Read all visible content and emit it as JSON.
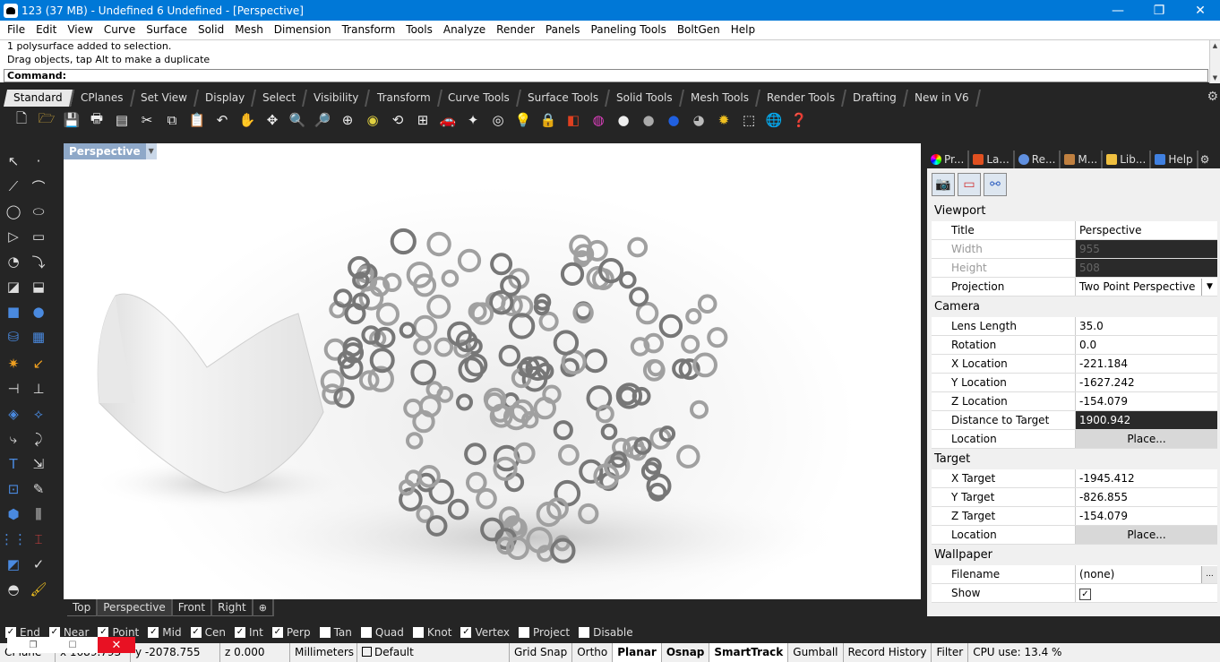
{
  "window": {
    "title": "123 (37 MB) - Undefined 6 Undefined - [Perspective]",
    "minimize": "—",
    "restore": "❐",
    "close": "✕"
  },
  "menu": [
    "File",
    "Edit",
    "View",
    "Curve",
    "Surface",
    "Solid",
    "Mesh",
    "Dimension",
    "Transform",
    "Tools",
    "Analyze",
    "Render",
    "Panels",
    "Paneling Tools",
    "BoltGen",
    "Help"
  ],
  "command": {
    "history": [
      "1 polysurface added to selection.",
      "Drag objects, tap Alt to make a duplicate"
    ],
    "prompt": "Command:",
    "value": ""
  },
  "toolbar_tabs": [
    "Standard",
    "CPlanes",
    "Set View",
    "Display",
    "Select",
    "Visibility",
    "Transform",
    "Curve Tools",
    "Surface Tools",
    "Solid Tools",
    "Mesh Tools",
    "Render Tools",
    "Drafting",
    "New in V6"
  ],
  "toolbar_icons": [
    "new-file-icon",
    "open-file-icon",
    "save-icon",
    "print-icon",
    "import-icon",
    "cut-icon",
    "copy-icon",
    "paste-icon",
    "undo-icon",
    "pan-hand-icon",
    "move-icon",
    "zoom-icon",
    "zoom-window-icon",
    "zoom-extents-icon",
    "zoom-selected-icon",
    "rotate-view-icon",
    "four-viewports-icon",
    "car-icon",
    "point-icon",
    "circle-icon",
    "light-icon",
    "lock-icon",
    "layer-icon",
    "color-wheel-icon",
    "sphere-grey-icon",
    "sphere-dark-icon",
    "sphere-blue-icon",
    "sphere-rendered-icon",
    "gear-sun-icon",
    "dashed-window-icon",
    "globe-icon",
    "help-icon"
  ],
  "viewport": {
    "title": "Perspective"
  },
  "viewport_tabs": [
    "Top",
    "Perspective",
    "Front",
    "Right"
  ],
  "panel": {
    "tabs": [
      "Pr...",
      "La...",
      "Re...",
      "M...",
      "Lib...",
      "Help"
    ],
    "sections": {
      "viewport": "Viewport",
      "camera": "Camera",
      "target": "Target",
      "wallpaper": "Wallpaper"
    },
    "viewport_rows": {
      "title_label": "Title",
      "title_value": "Perspective",
      "width_label": "Width",
      "width_value": "955",
      "height_label": "Height",
      "height_value": "508",
      "projection_label": "Projection",
      "projection_value": "Two Point Perspective"
    },
    "camera_rows": {
      "lens_label": "Lens Length",
      "lens_value": "35.0",
      "rotation_label": "Rotation",
      "rotation_value": "0.0",
      "x_label": "X Location",
      "x_value": "-221.184",
      "y_label": "Y Location",
      "y_value": "-1627.242",
      "z_label": "Z Location",
      "z_value": "-154.079",
      "dist_label": "Distance to Target",
      "dist_value": "1900.942",
      "loc_label": "Location",
      "loc_button": "Place..."
    },
    "target_rows": {
      "x_label": "X Target",
      "x_value": "-1945.412",
      "y_label": "Y Target",
      "y_value": "-826.855",
      "z_label": "Z Target",
      "z_value": "-154.079",
      "loc_label": "Location",
      "loc_button": "Place..."
    },
    "wallpaper_rows": {
      "file_label": "Filename",
      "file_value": "(none)",
      "file_button": "...",
      "show_label": "Show",
      "show_checked": true
    }
  },
  "osnaps": [
    {
      "label": "End",
      "checked": true
    },
    {
      "label": "Near",
      "checked": true
    },
    {
      "label": "Point",
      "checked": true
    },
    {
      "label": "Mid",
      "checked": true
    },
    {
      "label": "Cen",
      "checked": true
    },
    {
      "label": "Int",
      "checked": true
    },
    {
      "label": "Perp",
      "checked": true
    },
    {
      "label": "Tan",
      "checked": false
    },
    {
      "label": "Quad",
      "checked": false
    },
    {
      "label": "Knot",
      "checked": false
    },
    {
      "label": "Vertex",
      "checked": true
    },
    {
      "label": "Project",
      "checked": false
    },
    {
      "label": "Disable",
      "checked": false
    }
  ],
  "status": {
    "cplane": "CPlane",
    "x": "x 1689.793",
    "y": "y -2078.755",
    "z": "z 0.000",
    "units": "Millimeters",
    "layer": "Default",
    "grid_snap": "Grid Snap",
    "ortho": "Ortho",
    "planar": "Planar",
    "osnap": "Osnap",
    "smarttrack": "SmartTrack",
    "gumball": "Gumball",
    "record_history": "Record History",
    "filter": "Filter",
    "cpu": "CPU use: 13.4 %"
  }
}
